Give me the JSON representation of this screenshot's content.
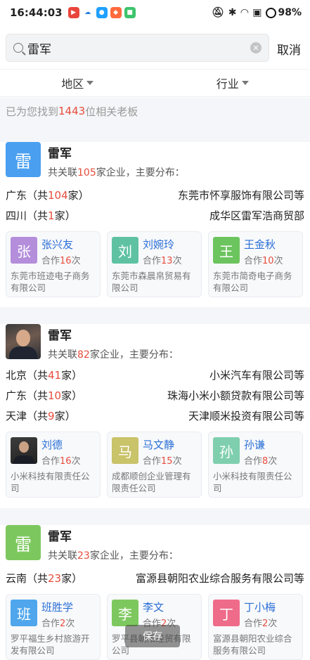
{
  "status": {
    "time": "16:44:03",
    "battery": "98%",
    "app_icons": [
      {
        "name": "video-app-icon",
        "color": "#e9453b",
        "glyph": "▶"
      },
      {
        "name": "cloud-app-icon",
        "color": "#ffffff",
        "glyph": "☁"
      },
      {
        "name": "qq-app-icon",
        "color": "#1fa0ff",
        "glyph": "●"
      },
      {
        "name": "shop-app-icon",
        "color": "#ff6a3c",
        "glyph": "◆"
      },
      {
        "name": "green-app-icon",
        "color": "#3cc46b",
        "glyph": "■"
      }
    ]
  },
  "search": {
    "query": "雷军",
    "cancel": "取消"
  },
  "filters": [
    {
      "label": "地区"
    },
    {
      "label": "行业"
    }
  ],
  "result": {
    "prefix": "已为您找到",
    "count": "1443",
    "suffix": "位相关老板"
  },
  "cards": [
    {
      "avatar_char": "雷",
      "avatar_color": "#4a9ff0",
      "name": "雷军",
      "sub_prefix": "共关联",
      "sub_count": "105",
      "sub_suffix": "家企业，主要分布：",
      "dist": [
        {
          "region": "广东（共",
          "count": "104",
          "unit": "家）",
          "company": "东莞市怀享服饰有限公司等"
        },
        {
          "region": "四川（共",
          "count": "1",
          "unit": "家）",
          "company": "成华区雷军浩商贸部"
        }
      ],
      "partners": [
        {
          "char": "张",
          "color": "#b48ddb",
          "name": "张兴友",
          "coop_prefix": "合作",
          "coop_count": "16",
          "coop_suffix": "次",
          "company": "东莞市班迹电子商务有限公司"
        },
        {
          "char": "刘",
          "color": "#5ec2a2",
          "name": "刘婉玲",
          "coop_prefix": "合作",
          "coop_count": "13",
          "coop_suffix": "次",
          "company": "东莞市森晨帛贸易有限公司"
        },
        {
          "char": "王",
          "color": "#6cc45e",
          "name": "王金秋",
          "coop_prefix": "合作",
          "coop_count": "10",
          "coop_suffix": "次",
          "company": "东莞市简奇电子商务有限公司"
        }
      ]
    },
    {
      "avatar_char": "",
      "avatar_color": "#444444",
      "name": "雷军",
      "sub_prefix": "共关联",
      "sub_count": "82",
      "sub_suffix": "家企业，主要分布：",
      "dist": [
        {
          "region": "北京（共",
          "count": "41",
          "unit": "家）",
          "company": "小米汽车有限公司等"
        },
        {
          "region": "广东（共",
          "count": "10",
          "unit": "家）",
          "company": "珠海小米小额贷款有限公司等"
        },
        {
          "region": "天津（共",
          "count": "9",
          "unit": "家）",
          "company": "天津顺米投资有限公司等"
        }
      ],
      "partners": [
        {
          "char": "",
          "color": "#333333",
          "name": "刘德",
          "coop_prefix": "合作",
          "coop_count": "16",
          "coop_suffix": "次",
          "company": "小米科技有限责任公司"
        },
        {
          "char": "马",
          "color": "#c9c36a",
          "name": "马文静",
          "coop_prefix": "合作",
          "coop_count": "15",
          "coop_suffix": "次",
          "company": "成都顺创企业管理有限责任公司"
        },
        {
          "char": "孙",
          "color": "#7fcfae",
          "name": "孙谦",
          "coop_prefix": "合作",
          "coop_count": "8",
          "coop_suffix": "次",
          "company": "小米科技有限责任公司"
        }
      ]
    },
    {
      "avatar_char": "雷",
      "avatar_color": "#7dc85e",
      "name": "雷军",
      "sub_prefix": "共关联",
      "sub_count": "23",
      "sub_suffix": "家企业，主要分布：",
      "dist": [
        {
          "region": "云南（共",
          "count": "23",
          "unit": "家）",
          "company": "富源县朝阳农业综合服务有限公司等"
        }
      ],
      "partners": [
        {
          "char": "班",
          "color": "#4fa6ec",
          "name": "班胜学",
          "coop_prefix": "合作",
          "coop_count": "2",
          "coop_suffix": "次",
          "company": "罗平福生乡村旅游开发有限公司"
        },
        {
          "char": "李",
          "color": "#7dc85e",
          "name": "李文",
          "coop_prefix": "合作",
          "coop_count": "2",
          "coop_suffix": "次",
          "company": "罗平县朝阳经贸有限公司"
        },
        {
          "char": "丁",
          "color": "#ef6b8a",
          "name": "丁小梅",
          "coop_prefix": "合作",
          "coop_count": "2",
          "coop_suffix": "次",
          "company": "富源县朝阳农业综合服务有限公司"
        }
      ]
    }
  ],
  "toast": "保存"
}
